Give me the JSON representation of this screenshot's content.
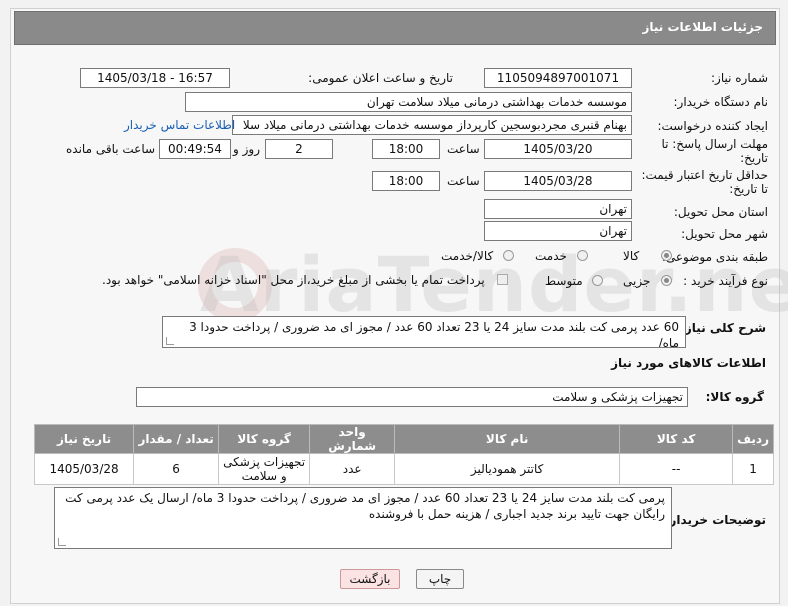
{
  "header": {
    "title": "جزئیات اطلاعات نیاز"
  },
  "form": {
    "need_number_label": "شماره نیاز:",
    "need_number": "1105094897001071",
    "announce_label": "تاریخ و ساعت اعلان عمومی:",
    "announce_value": "1405/03/18 - 16:57",
    "buyer_org_label": "نام دستگاه خریدار:",
    "buyer_org": "موسسه خدمات بهداشتی درمانی میلاد سلامت تهران",
    "requester_label": "ایجاد کننده درخواست:",
    "requester": "بهنام قنبری مجردبوسجین کارپرداز موسسه خدمات بهداشتی درمانی میلاد سلا",
    "contact_link": "اطلاعات تماس خریدار",
    "deadline_label_1": "مهلت ارسال پاسخ: تا",
    "deadline_label_2": "تاریخ:",
    "deadline_date": "1405/03/20",
    "time_word": "ساعت",
    "deadline_time": "18:00",
    "days_value": "2",
    "days_word": "روز و",
    "remaining_time": "00:49:54",
    "remaining_word": "ساعت باقی مانده",
    "price_label_1": "حداقل تاریخ اعتبار قیمت:",
    "price_label_2": "تا تاریخ:",
    "price_date": "1405/03/28",
    "price_time": "18:00",
    "province_label": "استان محل تحویل:",
    "province": "تهران",
    "city_label": "شهر محل تحویل:",
    "city": "تهران",
    "category_label": "طبقه بندی موضوعی:",
    "category_options": [
      "کالا",
      "خدمت",
      "کالا/خدمت"
    ],
    "process_label": "نوع فرآیند خرید :",
    "process_options": [
      "جزیی",
      "متوسط"
    ],
    "payment_note": "پرداخت تمام یا بخشی از مبلغ خرید،از محل \"اسناد خزانه اسلامی\" خواهد بود."
  },
  "summary": {
    "label": "شرح کلی نیاز:",
    "text": "60 عدد پرمی کت بلند مدت سایز 24 یا 23 تعداد 60 عدد   /  مجوز ای مد ضروری / پرداخت حدودا 3 ماه/"
  },
  "goods_section": {
    "title": "اطلاعات کالاهای مورد نیاز",
    "group_label": "گروه کالا:",
    "group_value": "تجهیزات پزشکی و سلامت"
  },
  "table": {
    "headers": [
      "ردیف",
      "کد کالا",
      "نام کالا",
      "واحد شمارش",
      "گروه کالا",
      "تعداد / مقدار",
      "تاریخ نیاز"
    ],
    "rows": [
      [
        "1",
        "--",
        "کاتتر همودیالیز",
        "عدد",
        "تجهیزات پزشکی و سلامت",
        "6",
        "1405/03/28"
      ]
    ]
  },
  "buyer_notes": {
    "label": "توضیحات خریدار:",
    "text": "پرمی کت بلند مدت سایز 24 یا 23 تعداد 60 عدد   /  مجوز ای مد ضروری / پرداخت حدودا 3 ماه/ ارسال یک عدد پرمی کت رایگان جهت  تایید برند جدید اجباری  / هزینه حمل با فروشنده"
  },
  "buttons": {
    "print": "چاپ",
    "back": "بازگشت"
  },
  "watermark": "AriaTender.neT"
}
